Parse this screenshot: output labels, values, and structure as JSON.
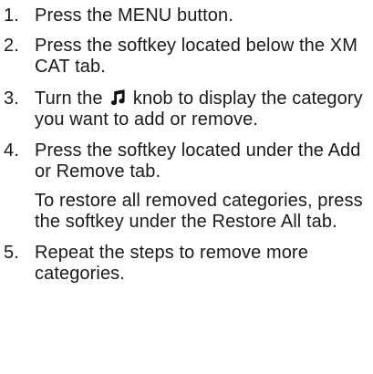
{
  "instructions": {
    "steps": [
      {
        "number": "1.",
        "text": "Press the MENU button."
      },
      {
        "number": "2.",
        "text": "Press the softkey located below the XM CAT tab."
      },
      {
        "number": "3.",
        "text_before_icon": "Turn the",
        "icon": "music-note-icon",
        "text_after_icon": "knob to display the category you want to add or remove."
      },
      {
        "number": "4.",
        "text": "Press the softkey located under the Add or Remove tab.",
        "note": "To restore all removed categories, press the softkey under the Restore All tab."
      },
      {
        "number": "5.",
        "text": "Repeat the steps to remove more categories."
      }
    ]
  }
}
